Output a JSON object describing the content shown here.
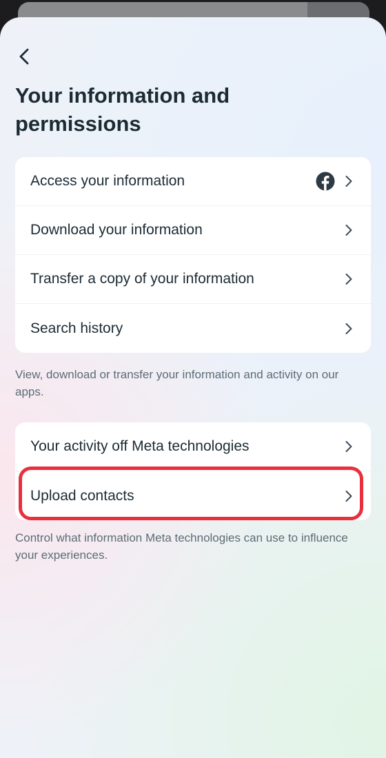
{
  "header": {
    "back_icon": "chevron-left-icon",
    "title": "Your information and permissions"
  },
  "section_information": {
    "items": [
      {
        "label": "Access your information",
        "icon": "facebook-icon"
      },
      {
        "label": "Download your information"
      },
      {
        "label": "Transfer a copy of your information"
      },
      {
        "label": "Search history"
      }
    ],
    "caption": "View, download or transfer your information and activity on our apps."
  },
  "section_permissions": {
    "items": [
      {
        "label": "Your activity off Meta technologies"
      },
      {
        "label": "Upload contacts",
        "highlighted": true
      }
    ],
    "caption": "Control what information Meta technologies can use to influence your experiences."
  },
  "colors": {
    "title_text": "#1c2b33",
    "caption_text": "#5c6b76",
    "highlight": "#e8303c",
    "facebook_icon": "#2d3a43"
  }
}
